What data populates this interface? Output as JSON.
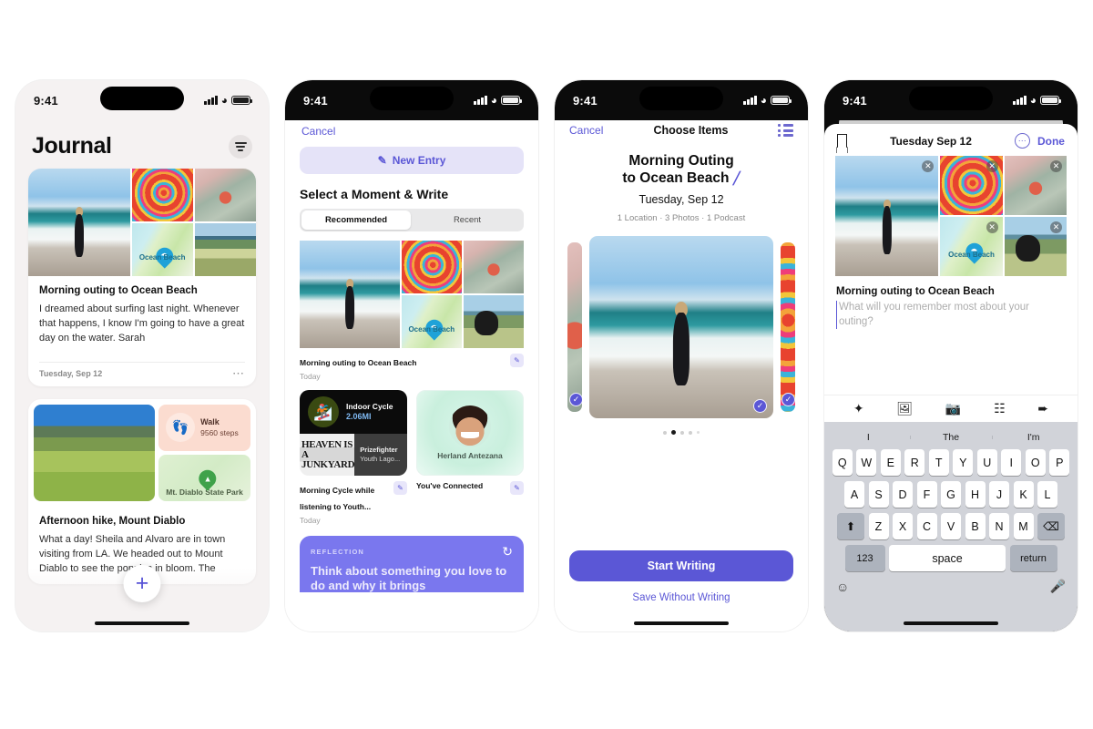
{
  "status_bar": {
    "time": "9:41"
  },
  "phone1": {
    "title": "Journal",
    "filter_icon": "filter-icon",
    "entries": [
      {
        "title": "Morning outing to Ocean Beach",
        "text": "I dreamed about surfing last night. Whenever that happens, I know I'm going to have a great day on the water. Sarah",
        "date": "Tuesday, Sep 12",
        "more_icon": "ellipsis-icon",
        "map_label": "Ocean Beach"
      },
      {
        "title": "Afternoon hike, Mount Diablo",
        "text": "What a day! Sheila and Alvaro are in town visiting from LA. We headed out to Mount Diablo to see the poppies in bloom. The",
        "walk_label": "Walk",
        "walk_value": "9560 steps",
        "park_label": "Mt. Diablo State Park"
      }
    ],
    "fab_label": "+"
  },
  "phone2": {
    "cancel": "Cancel",
    "new_entry": "New Entry",
    "section_title": "Select a Moment & Write",
    "segments": [
      {
        "label": "Recommended",
        "active": true
      },
      {
        "label": "Recent",
        "active": false
      }
    ],
    "suggestion_1": {
      "title": "Morning outing to Ocean Beach",
      "subtitle": "Today",
      "map_label": "Ocean Beach"
    },
    "suggestion_2": {
      "workout_name": "Indoor Cycle",
      "workout_distance": "2.06MI",
      "album_title": "HEAVEN IS A JUNKYARD",
      "podcast_name": "Prizefighter",
      "podcast_show": "Youth Lago...",
      "title": "Morning Cycle while listening to Youth...",
      "subtitle": "Today"
    },
    "suggestion_3": {
      "person": "Herland Antezana",
      "title": "You've Connected"
    },
    "reflection": {
      "kicker": "REFLECTION",
      "text": "Think about something you love to do and why it brings",
      "refresh_icon": "refresh-icon"
    }
  },
  "phone3": {
    "cancel": "Cancel",
    "nav_title": "Choose Items",
    "list_icon": "list-icon",
    "title_line1": "Morning Outing",
    "title_line2": "to Ocean Beach",
    "edit_icon": "pencil-icon",
    "date": "Tuesday, Sep 12",
    "meta": "1 Location · 3 Photos · 1 Podcast",
    "dots_count": 5,
    "active_dot": 1,
    "primary_button": "Start Writing",
    "secondary_button": "Save Without Writing"
  },
  "phone4": {
    "bookmark_icon": "bookmark-icon",
    "nav_title": "Tuesday Sep 12",
    "more_icon": "ellipsis-circle-icon",
    "done": "Done",
    "entry_title": "Morning outing to Ocean Beach",
    "entry_placeholder": "What will you remember most about your outing?",
    "map_label": "Ocean Beach",
    "toolbar_icons": [
      "sparkle-wand-icon",
      "photos-icon",
      "camera-icon",
      "audio-waveform-icon",
      "location-arrow-icon"
    ],
    "predictions": [
      "I",
      "The",
      "I'm"
    ],
    "keyboard": {
      "row1": [
        "Q",
        "W",
        "E",
        "R",
        "T",
        "Y",
        "U",
        "I",
        "O",
        "P"
      ],
      "row2": [
        "A",
        "S",
        "D",
        "F",
        "G",
        "H",
        "J",
        "K",
        "L"
      ],
      "row3": [
        "Z",
        "X",
        "C",
        "V",
        "B",
        "N",
        "M"
      ],
      "shift": "⬆",
      "backspace": "⌫",
      "numbers": "123",
      "space": "space",
      "return": "return",
      "emoji_icon": "emoji-icon",
      "mic_icon": "microphone-icon"
    }
  },
  "colors": {
    "accent": "#5b57d6",
    "reflection_bg": "#7a77ee",
    "page_bg": "#f5f2f2"
  }
}
